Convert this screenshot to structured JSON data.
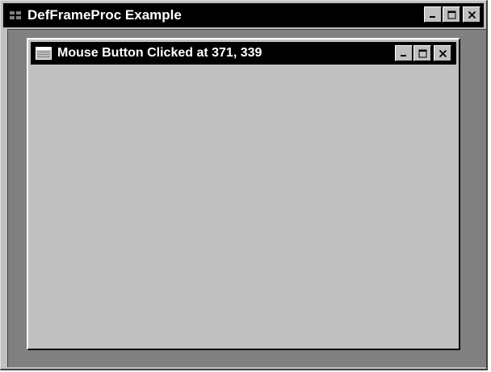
{
  "main_window": {
    "title": "DefFrameProc Example",
    "buttons": {
      "minimize": "minimize-icon",
      "maximize": "maximize-icon",
      "close": "close-icon"
    }
  },
  "child_window": {
    "title": "Mouse Button Clicked at 371, 339",
    "buttons": {
      "minimize": "minimize-icon",
      "maximize": "maximize-icon",
      "close": "close-icon"
    }
  },
  "colors": {
    "titlebar": "#000000",
    "title_text": "#ffffff",
    "window_face": "#c0c0c0",
    "mdi_background": "#808080"
  }
}
